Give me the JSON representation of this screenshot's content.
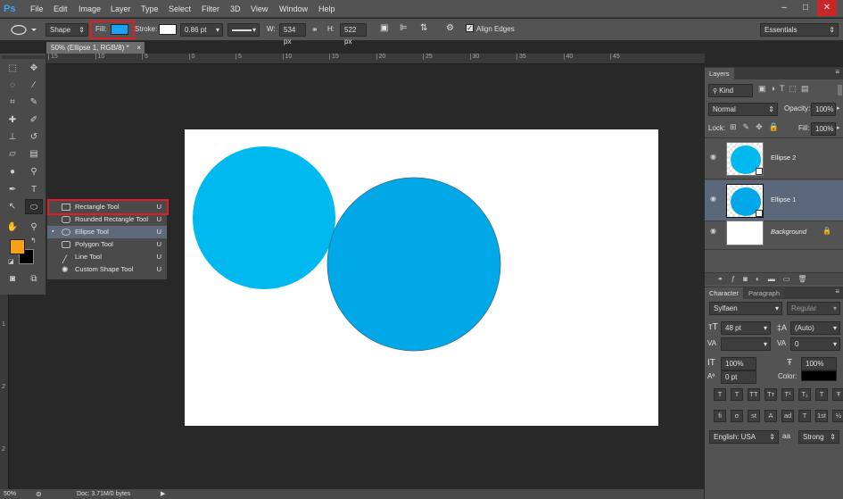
{
  "app": {
    "logo": "Ps"
  },
  "menu": [
    "File",
    "Edit",
    "Image",
    "Layer",
    "Type",
    "Select",
    "Filter",
    "3D",
    "View",
    "Window",
    "Help"
  ],
  "window_controls": {
    "minimize": "–",
    "maximize": "□",
    "close": "✕"
  },
  "options": {
    "tool_icon": "ellipse-icon",
    "mode": "Shape",
    "fill_label": "Fill:",
    "fill_color": "#1aa3f0",
    "stroke_label": "Stroke:",
    "stroke_color": "#ffffff",
    "stroke_width": "0.86 pt",
    "w_label": "W:",
    "w_value": "534 px",
    "h_label": "H:",
    "h_value": "522 px",
    "align_edges_label": "Align Edges",
    "align_edges_checked": true,
    "workspace": "Essentials"
  },
  "document": {
    "tab_title": "50% (Ellipse 1, RGB/8) *",
    "ruler_top": [
      "15",
      "10",
      "5",
      "0",
      "5",
      "10",
      "15",
      "20",
      "25",
      "30",
      "35",
      "40",
      "45"
    ],
    "ruler_left": [
      "5",
      "0",
      "5",
      "1",
      "1",
      "2",
      "2"
    ],
    "ellipse1_color": "#00a8e8",
    "ellipse2_color": "#00b9ef",
    "canvas_color": "#ffffff"
  },
  "toolbox": {
    "fg_color": "#f7a11a",
    "bg_color": "#000000",
    "tools": [
      "marquee-icon",
      "move-icon",
      "lasso-icon",
      "magic-wand-icon",
      "crop-icon",
      "eyedropper-icon",
      "healing-icon",
      "brush-icon",
      "stamp-icon",
      "history-brush-icon",
      "eraser-icon",
      "gradient-icon",
      "blur-icon",
      "dodge-icon",
      "pen-icon",
      "type-icon",
      "path-select-icon",
      "ellipse-tool-icon",
      "hand-icon",
      "zoom-icon"
    ]
  },
  "flyout": {
    "items": [
      {
        "name": "Rectangle Tool",
        "key": "U",
        "icon": "rectangle-icon"
      },
      {
        "name": "Rounded Rectangle Tool",
        "key": "U",
        "icon": "rounded-rectangle-icon"
      },
      {
        "name": "Ellipse Tool",
        "key": "U",
        "icon": "ellipse-icon",
        "selected": true
      },
      {
        "name": "Polygon Tool",
        "key": "U",
        "icon": "polygon-icon"
      },
      {
        "name": "Line Tool",
        "key": "U",
        "icon": "line-icon"
      },
      {
        "name": "Custom Shape Tool",
        "key": "U",
        "icon": "custom-shape-icon"
      }
    ]
  },
  "layers_panel": {
    "tab": "Layers",
    "kind_filter": "Kind",
    "blend_mode": "Normal",
    "opacity_label": "Opacity:",
    "opacity": "100%",
    "lock_label": "Lock:",
    "fill_label": "Fill:",
    "fill": "100%",
    "layers": [
      {
        "name": "Ellipse 2",
        "selected": false
      },
      {
        "name": "Ellipse 1",
        "selected": true
      },
      {
        "name": "Background",
        "selected": false
      }
    ]
  },
  "character_panel": {
    "tabs": [
      "Character",
      "Paragraph"
    ],
    "font_family": "Sylfaen",
    "font_style": "Regular",
    "font_size": "48 pt",
    "leading": "(Auto)",
    "tracking": "0",
    "vertical_scale": "100%",
    "horizontal_scale": "100%",
    "baseline_shift": "0 pt",
    "color_label": "Color:",
    "text_color": "#000000",
    "style_buttons": [
      "T",
      "T",
      "TT",
      "Tт",
      "T¹",
      "T₁",
      "T",
      "Ŧ"
    ],
    "opentype_buttons": [
      "fi",
      "σ",
      "st",
      "A",
      "ad",
      "T",
      "1st",
      "½"
    ],
    "language": "English: USA",
    "antialias_label": "aa",
    "antialias": "Strong"
  },
  "status": {
    "zoom": "50%",
    "doc_info": "Doc: 3.71M/0 bytes"
  }
}
